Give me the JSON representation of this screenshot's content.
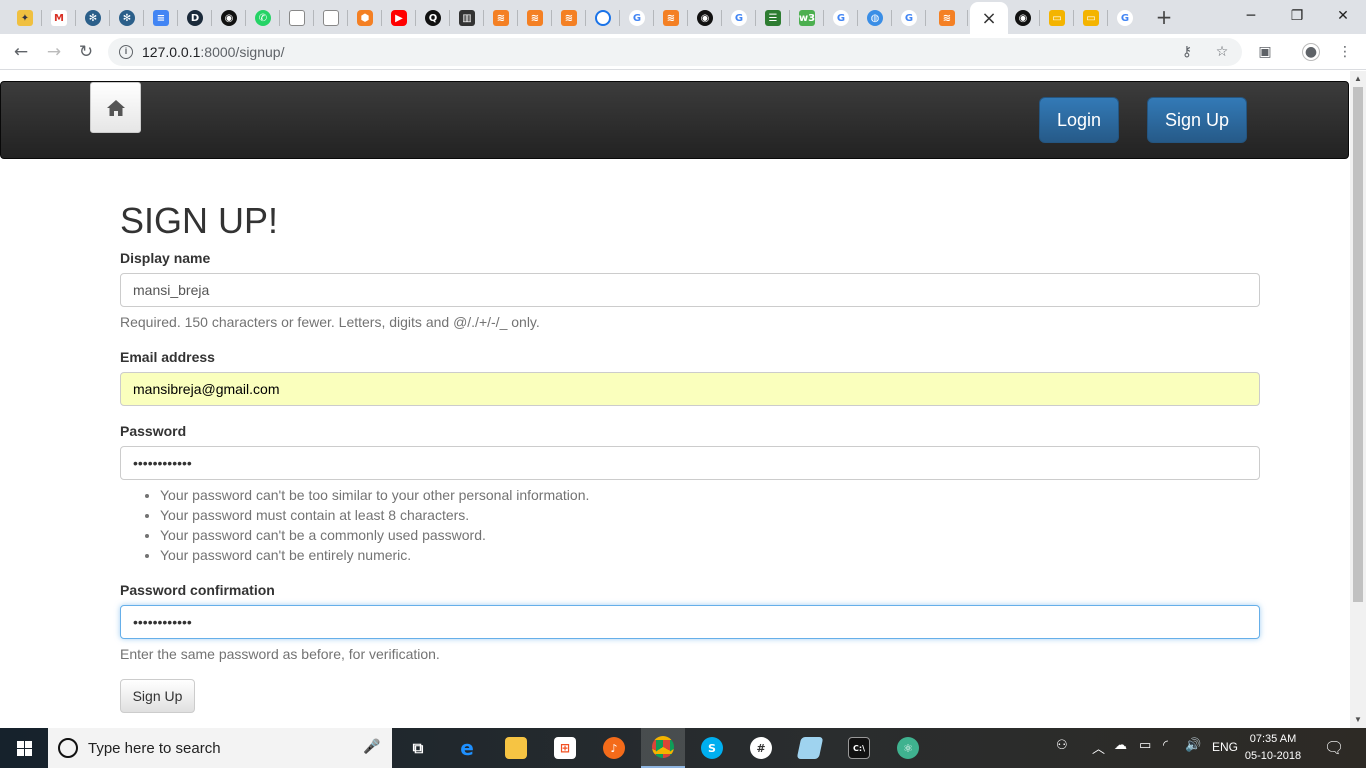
{
  "browser": {
    "tab_count": 30,
    "active_tab_close": "×",
    "new_tab": "+",
    "url_host": "127.0.0.1",
    "url_path": ":8000/signup/"
  },
  "navbar": {
    "home_icon": "home-icon",
    "login_label": "Login",
    "signup_label": "Sign Up"
  },
  "form": {
    "title": "SIGN UP!",
    "display_name_label": "Display name",
    "display_name_value": "mansi_breja",
    "display_name_help": "Required. 150 characters or fewer. Letters, digits and @/./+/-/_ only.",
    "email_label": "Email address",
    "email_value": "mansibreja@gmail.com",
    "password_label": "Password",
    "password_value": "••••••••••••",
    "password_rules": [
      "Your password can't be too similar to your other personal information.",
      "Your password must contain at least 8 characters.",
      "Your password can't be a commonly used password.",
      "Your password can't be entirely numeric."
    ],
    "confirm_label": "Password confirmation",
    "confirm_value": "••••••••••••",
    "confirm_help": "Enter the same password as before, for verification.",
    "submit_label": "Sign Up"
  },
  "taskbar": {
    "search_placeholder": "Type here to search",
    "language": "ENG",
    "time": "07:35 AM",
    "date": "05-10-2018"
  },
  "colors": {
    "navbar_bg": "#222222",
    "primary_button": "#337ab7",
    "autofill_bg": "#faffbd",
    "focus_border": "#66afe9"
  }
}
